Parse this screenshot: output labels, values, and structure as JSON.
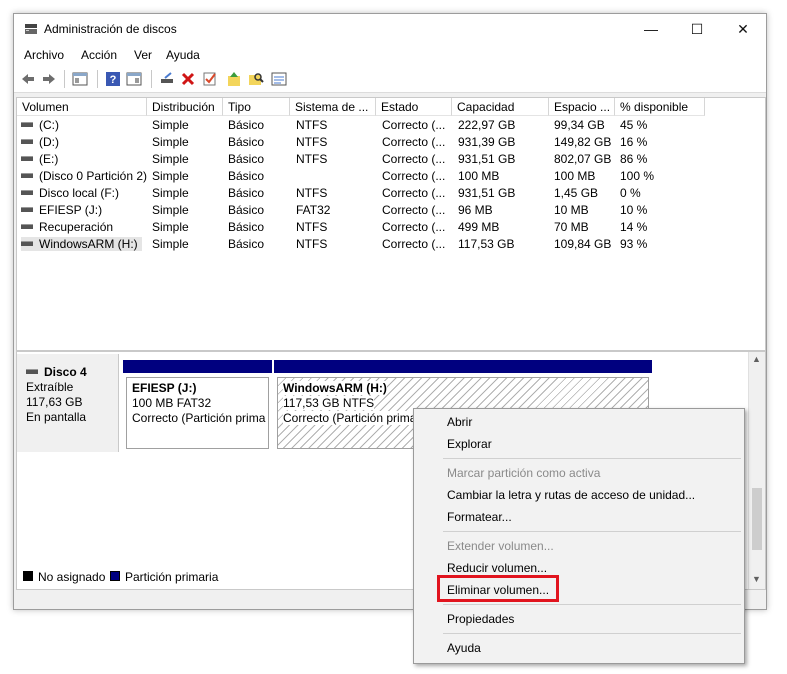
{
  "window": {
    "title": "Administración de discos",
    "controls": {
      "minimize": "—",
      "maximize": "☐",
      "close": "✕"
    }
  },
  "menu": [
    "Archivo",
    "Acción",
    "Ver",
    "Ayuda"
  ],
  "toolbar_icons": [
    "back-icon",
    "forward-icon",
    "view-icon",
    "help-icon",
    "console-icon",
    "connect-icon",
    "delete-icon",
    "check-icon",
    "up-icon",
    "search-icon",
    "properties-icon"
  ],
  "columns": [
    "Volumen",
    "Distribución",
    "Tipo",
    "Sistema de ...",
    "Estado",
    "Capacidad",
    "Espacio ...",
    "% disponible"
  ],
  "volumes": [
    {
      "name": "(C:)",
      "layout": "Simple",
      "type": "Básico",
      "fs": "NTFS",
      "status": "Correcto (...",
      "capacity": "222,97 GB",
      "free": "99,34 GB",
      "pct": "45 %"
    },
    {
      "name": "(D:)",
      "layout": "Simple",
      "type": "Básico",
      "fs": "NTFS",
      "status": "Correcto (...",
      "capacity": "931,39 GB",
      "free": "149,82 GB",
      "pct": "16 %"
    },
    {
      "name": "(E:)",
      "layout": "Simple",
      "type": "Básico",
      "fs": "NTFS",
      "status": "Correcto (...",
      "capacity": "931,51 GB",
      "free": "802,07 GB",
      "pct": "86 %"
    },
    {
      "name": "(Disco 0 Partición 2)",
      "layout": "Simple",
      "type": "Básico",
      "fs": "",
      "status": "Correcto (...",
      "capacity": "100 MB",
      "free": "100 MB",
      "pct": "100 %"
    },
    {
      "name": "Disco local (F:)",
      "layout": "Simple",
      "type": "Básico",
      "fs": "NTFS",
      "status": "Correcto (...",
      "capacity": "931,51 GB",
      "free": "1,45 GB",
      "pct": "0 %"
    },
    {
      "name": "EFIESP (J:)",
      "layout": "Simple",
      "type": "Básico",
      "fs": "FAT32",
      "status": "Correcto (...",
      "capacity": "96 MB",
      "free": "10 MB",
      "pct": "10 %"
    },
    {
      "name": "Recuperación",
      "layout": "Simple",
      "type": "Básico",
      "fs": "NTFS",
      "status": "Correcto (...",
      "capacity": "499 MB",
      "free": "70 MB",
      "pct": "14 %"
    },
    {
      "name": "WindowsARM (H:)",
      "layout": "Simple",
      "type": "Básico",
      "fs": "NTFS",
      "status": "Correcto (...",
      "capacity": "117,53 GB",
      "free": "109,84 GB",
      "pct": "93 %"
    }
  ],
  "disk": {
    "name": "Disco 4",
    "kind": "Extraíble",
    "size": "117,63 GB",
    "state": "En pantalla",
    "partitions": [
      {
        "label": "EFIESP  (J:)",
        "size": "100 MB FAT32",
        "status": "Correcto (Partición prima"
      },
      {
        "label": "WindowsARM  (H:)",
        "size": "117,53 GB NTFS",
        "status": "Correcto (Partición prima"
      }
    ]
  },
  "legend": {
    "unallocated": "No asignado",
    "primary": "Partición primaria",
    "colors": {
      "unallocated": "#000000",
      "primary": "#00007f"
    }
  },
  "context_menu": {
    "items": [
      {
        "label": "Abrir",
        "disabled": false
      },
      {
        "label": "Explorar",
        "disabled": false
      },
      {
        "label": "Marcar partición como activa",
        "disabled": true
      },
      {
        "label": "Cambiar la letra y rutas de acceso de unidad...",
        "disabled": false
      },
      {
        "label": "Formatear...",
        "disabled": false
      },
      {
        "label": "Extender volumen...",
        "disabled": true
      },
      {
        "label": "Reducir volumen...",
        "disabled": false
      },
      {
        "label": "Eliminar volumen...",
        "disabled": false
      },
      {
        "label": "Propiedades",
        "disabled": false
      },
      {
        "label": "Ayuda",
        "disabled": false
      }
    ],
    "highlight_color": "#e1141e"
  }
}
